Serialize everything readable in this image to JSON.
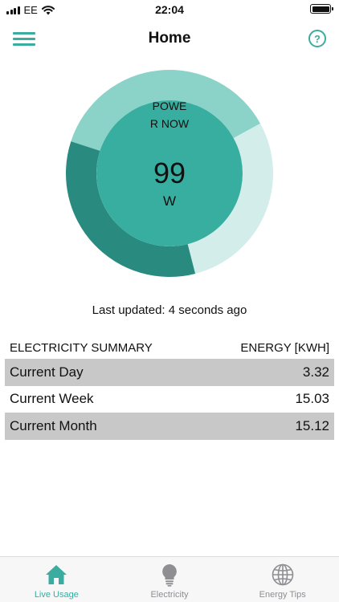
{
  "status_bar": {
    "carrier": "EE",
    "time": "22:04",
    "icons": [
      "signal-icon",
      "wifi-icon",
      "battery-icon"
    ]
  },
  "nav": {
    "title": "Home",
    "left_icon": "hamburger-menu-icon",
    "right_icon": "help-question-icon",
    "help_glyph": "?"
  },
  "power_gauge": {
    "label": "POWER NOW",
    "value": "99",
    "unit": "W",
    "segments": [
      {
        "share": 0.37,
        "color": "#8bd3c8"
      },
      {
        "share": 0.29,
        "color": "#d3eeea"
      },
      {
        "share": 0.34,
        "color": "#298a7f"
      }
    ],
    "inner_color": "#37ae9f"
  },
  "last_updated": "Last updated: 4 seconds ago",
  "summary": {
    "header_left": "ELECTRICITY SUMMARY",
    "header_right": "ENERGY [KWH]",
    "rows": [
      {
        "label": "Current Day",
        "value": "3.32"
      },
      {
        "label": "Current Week",
        "value": "15.03"
      },
      {
        "label": "Current Month",
        "value": "15.12"
      }
    ]
  },
  "tabs": [
    {
      "label": "Live Usage",
      "icon": "house-icon",
      "active": true
    },
    {
      "label": "Electricity",
      "icon": "lightbulb-icon",
      "active": false
    },
    {
      "label": "Energy Tips",
      "icon": "globe-icon",
      "active": false
    }
  ],
  "colors": {
    "accent": "#3aada0",
    "inactive": "#8e8e93",
    "row_shade": "#c8c8c8"
  }
}
